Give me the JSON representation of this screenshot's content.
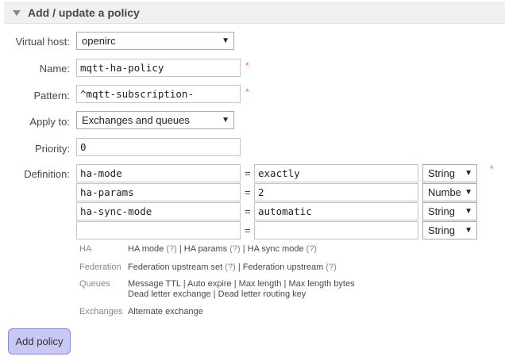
{
  "section": {
    "title": "Add / update a policy"
  },
  "form": {
    "vhost": {
      "label": "Virtual host:",
      "value": "openirc"
    },
    "name": {
      "label": "Name:",
      "value": "mqtt-ha-policy"
    },
    "pattern": {
      "label": "Pattern:",
      "value": "^mqtt-subscription-"
    },
    "apply_to": {
      "label": "Apply to:",
      "value": "Exchanges and queues"
    },
    "priority": {
      "label": "Priority:",
      "value": "0"
    },
    "definition_label": "Definition:",
    "required_mark": "*",
    "equals": "=",
    "definition_rows": [
      {
        "key": "ha-mode",
        "value": "exactly",
        "type": "String"
      },
      {
        "key": "ha-params",
        "value": "2",
        "type": "Numbe"
      },
      {
        "key": "ha-sync-mode",
        "value": "automatic",
        "type": "String"
      },
      {
        "key": "",
        "value": "",
        "type": "String"
      }
    ]
  },
  "help": {
    "ha": {
      "category": "HA",
      "items": [
        {
          "label": "HA mode",
          "hint": "(?)"
        },
        {
          "label": "HA params",
          "hint": "(?)"
        },
        {
          "label": "HA sync mode",
          "hint": "(?)"
        }
      ]
    },
    "federation": {
      "category": "Federation",
      "items": [
        {
          "label": "Federation upstream set",
          "hint": "(?)"
        },
        {
          "label": "Federation upstream",
          "hint": "(?)"
        }
      ]
    },
    "queues": {
      "category": "Queues",
      "items": [
        "Message TTL",
        "Auto expire",
        "Max length",
        "Max length bytes",
        "Dead letter exchange",
        "Dead letter routing key"
      ]
    },
    "exchanges": {
      "category": "Exchanges",
      "items": [
        "Alternate exchange"
      ]
    },
    "separator": "|"
  },
  "actions": {
    "add_policy_label": "Add policy"
  },
  "icons": {
    "collapse": "triangle-down-icon",
    "dropdown": "dropdown-arrow-icon"
  },
  "colors": {
    "button_bg": "#c8c8f4",
    "required": "#e06a6a",
    "header_bg": "#f0f0f0"
  }
}
